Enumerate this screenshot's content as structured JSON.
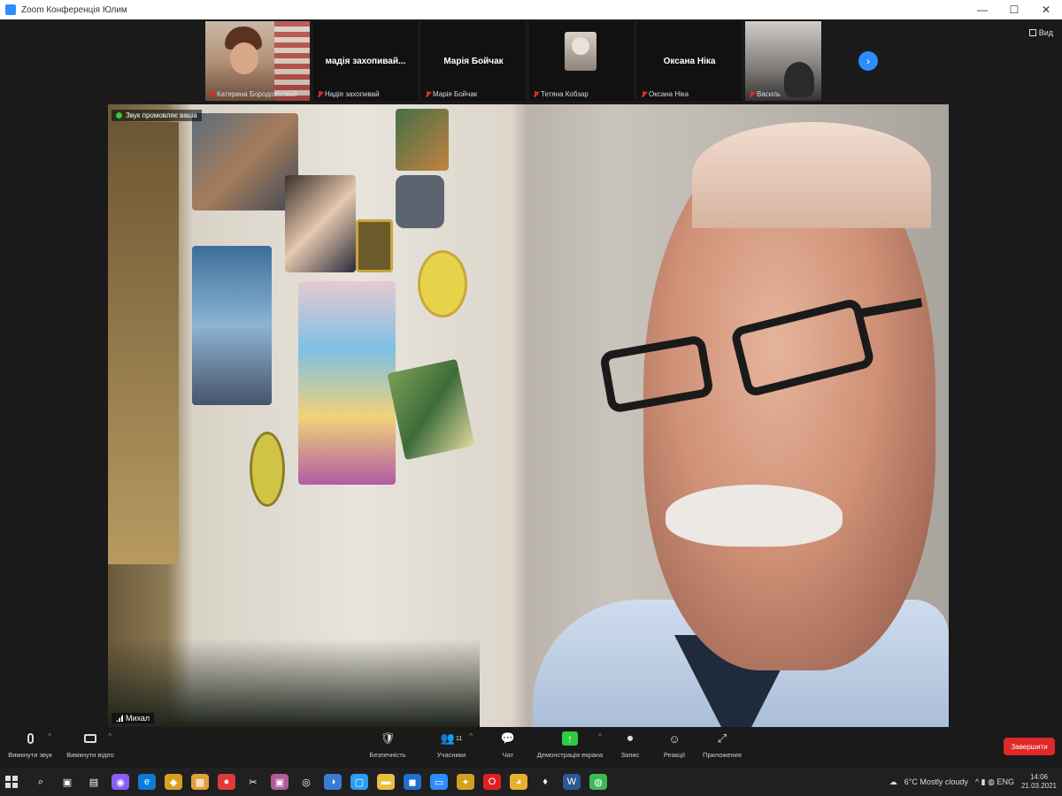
{
  "window": {
    "title": "Zoom Конференція Юлим",
    "controls": [
      "—",
      "☐",
      "✕"
    ]
  },
  "gallery": {
    "tiles": [
      {
        "kind": "video",
        "name": "",
        "label": "Катерина Бородоволвай"
      },
      {
        "kind": "name",
        "name": "мадія захопивай...",
        "label": "Надія захопивай"
      },
      {
        "kind": "name",
        "name": "Марія Бойчак",
        "label": "Марія Бойчак"
      },
      {
        "kind": "avatar",
        "name": "",
        "label": "Тетяна Кобзар"
      },
      {
        "kind": "name",
        "name": "Оксана Ніка",
        "label": "Оксана Ніка"
      },
      {
        "kind": "video",
        "name": "",
        "label": "Василь"
      }
    ],
    "next_arrow": "›",
    "view_label": "Вид"
  },
  "speaker": {
    "active_label": "Звук промовляє ваша",
    "name": "Михал"
  },
  "toolbar": {
    "items": [
      {
        "icon": "mic",
        "label": "Вимкнути звук",
        "caret": "^"
      },
      {
        "icon": "camera",
        "label": "Вимкнути відео",
        "caret": "^"
      },
      {
        "icon": "🛡",
        "label": "Безпечність"
      },
      {
        "icon": "👥",
        "label": "Учасники",
        "count": "11",
        "caret": "^"
      },
      {
        "icon": "💬",
        "label": "Чат"
      },
      {
        "icon": "share",
        "label": "Демонстрація екрана",
        "caret": "^"
      },
      {
        "icon": "⏺",
        "label": "Запис"
      },
      {
        "icon": "☺",
        "label": "Реакції"
      },
      {
        "icon": "⤢",
        "label": "Приложения"
      }
    ],
    "end_label": "Завершити"
  },
  "taskbar": {
    "apps": [
      {
        "glyph": "⌕",
        "color": "#202020"
      },
      {
        "glyph": "▣",
        "color": "#202020"
      },
      {
        "glyph": "▤",
        "color": "#202020"
      },
      {
        "glyph": "◉",
        "color": "#8b5cf6"
      },
      {
        "glyph": "e",
        "color": "#0a7cd8"
      },
      {
        "glyph": "◆",
        "color": "#d8a020"
      },
      {
        "glyph": "▦",
        "color": "#e0a040"
      },
      {
        "glyph": "●",
        "color": "#e03a3a"
      },
      {
        "glyph": "✂",
        "color": "#202020"
      },
      {
        "glyph": "▣",
        "color": "#b05a9a"
      },
      {
        "glyph": "◎",
        "color": "#202020"
      },
      {
        "glyph": "◑",
        "color": "#3a7bd5"
      },
      {
        "glyph": "▢",
        "color": "#2a9df4"
      },
      {
        "glyph": "▬",
        "color": "#e8c040"
      },
      {
        "glyph": "◼",
        "color": "#1e6fd0"
      },
      {
        "glyph": "▭",
        "color": "#2d8cff"
      },
      {
        "glyph": "✦",
        "color": "#d0a020"
      },
      {
        "glyph": "O",
        "color": "#e02020"
      },
      {
        "glyph": "◕",
        "color": "#e8b030"
      },
      {
        "glyph": "♦",
        "color": "#202020"
      },
      {
        "glyph": "W",
        "color": "#2b5797"
      },
      {
        "glyph": "◍",
        "color": "#3cba54"
      }
    ],
    "weather": "6°C  Mostly cloudy",
    "tray_icons": "^  ▮  ◍  ENG",
    "time": "14:06",
    "date": "21.03.2021"
  }
}
